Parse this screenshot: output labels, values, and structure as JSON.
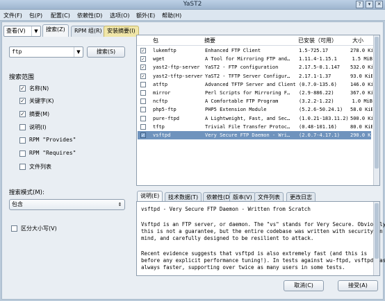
{
  "window": {
    "title": "YaST2",
    "controls": [
      "?",
      "▾",
      "✕"
    ]
  },
  "menu": [
    "文件(F)",
    "包(P)",
    "配置(C)",
    "依赖性(D)",
    "选项(O)",
    "额外(E)",
    "帮助(H)"
  ],
  "view_tabs": {
    "view": "查看(V)",
    "search": "搜索(Z)",
    "rpm_groups": "RPM 组(R)",
    "install_summary": "安装摘要(I)"
  },
  "search": {
    "value": "ftp",
    "button": "搜索(S)"
  },
  "scope": {
    "title": "搜索范围",
    "options": [
      {
        "label": "名称(N)",
        "checked": true
      },
      {
        "label": "关键字(K)",
        "checked": true
      },
      {
        "label": "摘要(M)",
        "checked": true
      },
      {
        "label": "说明(I)",
        "checked": false
      },
      {
        "label": "RPM \"Provides\"",
        "checked": false
      },
      {
        "label": "RPM \"Requires\"",
        "checked": false
      },
      {
        "label": "文件列表",
        "checked": false
      }
    ]
  },
  "search_mode": {
    "label": "搜索模式(M):",
    "value": "包含"
  },
  "case_sensitive": {
    "label": "区分大小写(V)",
    "checked": false
  },
  "table": {
    "headers": [
      "包",
      "摘要",
      "已安装（可用）",
      "大小"
    ],
    "rows": [
      {
        "status": "installed",
        "name": "lukemftp",
        "summary": "Enhanced FTP Client",
        "version": "1.5-725.17",
        "size": "278.0 KiB"
      },
      {
        "status": "installed",
        "name": "wget",
        "summary": "A Tool for Mirroring FTP and…",
        "version": "1.11.4-1.15.1",
        "size": "1.5 MiB"
      },
      {
        "status": "installed",
        "name": "yast2-ftp-server",
        "summary": "YaST2 - FTP configuration",
        "version": "2.17.5-0.1.147",
        "size": "532.0 KiB"
      },
      {
        "status": "installed",
        "name": "yast2-tftp-server",
        "summary": "YaST2 - TFTP Server Configur…",
        "version": "2.17.1-1.37",
        "size": "93.0 KiB"
      },
      {
        "status": "available",
        "name": "atftp",
        "summary": "Advanced TFTP Server and Client",
        "version": "(0.7.0-135.6)",
        "size": "146.0 KiB"
      },
      {
        "status": "available",
        "name": "mirror",
        "summary": "Perl Scripts for Mirroring F…",
        "version": "(2.9-886.22)",
        "size": "367.0 KiB"
      },
      {
        "status": "available",
        "name": "ncftp",
        "summary": "A Comfortable FTP Program",
        "version": "(3.2.2-1.22)",
        "size": "1.0 MiB"
      },
      {
        "status": "available",
        "name": "php5-ftp",
        "summary": "PHP5 Extension Module",
        "version": "(5.2.6-50.24.1)",
        "size": "58.0 KiB"
      },
      {
        "status": "available",
        "name": "pure-ftpd",
        "summary": "A Lightweight, Fast, and Sec…",
        "version": "(1.0.21-183.11.2)",
        "size": "500.0 KiB"
      },
      {
        "status": "available",
        "name": "tftp",
        "summary": "Trivial File Transfer Protoc…",
        "version": "(0.48-101.16)",
        "size": "80.0 KiB"
      },
      {
        "status": "to-install",
        "name": "vsftpd",
        "summary": "Very Secure FTP Daemon - Wri…",
        "version": "(2.0.7-4.17.1)",
        "size": "290.0 KiB"
      }
    ]
  },
  "detail_tabs": [
    "说明(E)",
    "技术数据(T)",
    "依赖性(D)",
    "版本(V)",
    "文件列表",
    "更改日志"
  ],
  "description": [
    "vsftpd - Very Secure FTP Daemon - Written from Scratch",
    "",
    "Vsftpd is an FTP server, or daemon. The \"vs\" stands for Very Secure. Obviously",
    "this is not a guarantee, but the entire codebase was written with security in",
    "mind, and carefully designed to be resilient to attack.",
    "",
    "Recent evidence suggests that vsftpd is also extremely fast (and this is",
    "before any explicit performance tuning!). In tests against wu-ftpd, vsftpd was",
    "always faster, supporting over twice as many users in some tests."
  ],
  "buttons": {
    "cancel": "取消(C)",
    "accept": "接受(A)"
  }
}
